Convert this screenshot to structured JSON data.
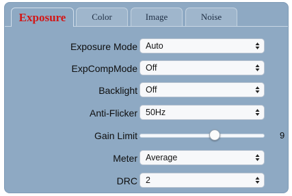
{
  "tabs": [
    {
      "label": "Exposure",
      "active": true
    },
    {
      "label": "Color",
      "active": false
    },
    {
      "label": "Image",
      "active": false
    },
    {
      "label": "Noise",
      "active": false
    }
  ],
  "settings": {
    "exposure_mode": {
      "label": "Exposure Mode",
      "value": "Auto"
    },
    "exp_comp_mode": {
      "label": "ExpCompMode",
      "value": "Off"
    },
    "backlight": {
      "label": "Backlight",
      "value": "Off"
    },
    "anti_flicker": {
      "label": "Anti-Flicker",
      "value": "50Hz"
    },
    "gain_limit": {
      "label": "Gain Limit",
      "value": "9",
      "level": 0.6
    },
    "meter": {
      "label": "Meter",
      "value": "Average"
    },
    "drc": {
      "label": "DRC",
      "value": "2"
    }
  },
  "colors": {
    "panel_bg": "#8ea9c3",
    "active_tab_text": "#d31717"
  },
  "icons": {
    "select_arrows": "updown-arrows-icon"
  }
}
